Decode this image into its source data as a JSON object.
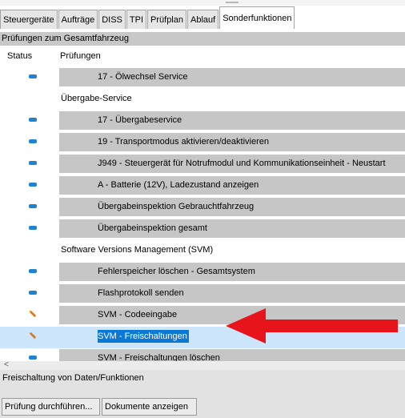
{
  "tabs": [
    {
      "label": "Steuergeräte",
      "active": false
    },
    {
      "label": "Aufträge",
      "active": false
    },
    {
      "label": "DISS",
      "active": false
    },
    {
      "label": "TPI",
      "active": false
    },
    {
      "label": "Prüfplan",
      "active": false
    },
    {
      "label": "Ablauf",
      "active": false
    },
    {
      "label": "Sonderfunktionen",
      "active": true
    }
  ],
  "section_header": "Prüfungen zum Gesamtfahrzeug",
  "columns": {
    "status": "Status",
    "pruefungen": "Prüfungen"
  },
  "rows": [
    {
      "type": "item",
      "label": "17 - Ölwechsel Service",
      "status_icon": "status-dash-icon"
    },
    {
      "type": "group",
      "label": "Übergabe-Service"
    },
    {
      "type": "item",
      "label": "17 - Übergabeservice",
      "status_icon": "status-dash-icon"
    },
    {
      "type": "item",
      "label": "19 - Transportmodus aktivieren/deaktivieren",
      "status_icon": "status-dash-icon"
    },
    {
      "type": "item",
      "label": "J949 - Steuergerät für Notrufmodul und Kommunikationseinheit - Neustart",
      "status_icon": "status-dash-icon"
    },
    {
      "type": "item",
      "label": "A - Batterie (12V), Ladezustand anzeigen",
      "status_icon": "status-dash-icon"
    },
    {
      "type": "item",
      "label": "Übergabeinspektion Gebrauchtfahrzeug",
      "status_icon": "status-dash-icon"
    },
    {
      "type": "item",
      "label": "Übergabeinspektion gesamt",
      "status_icon": "status-dash-icon"
    },
    {
      "type": "group",
      "label": "Software Versions Management (SVM)"
    },
    {
      "type": "item",
      "label": "Fehlerspeicher löschen - Gesamtsystem",
      "status_icon": "status-dash-icon"
    },
    {
      "type": "item",
      "label": "Flashprotokoll senden",
      "status_icon": "status-dash-icon"
    },
    {
      "type": "item",
      "label": "SVM - Codeeingabe",
      "status_icon": "pen-icon"
    },
    {
      "type": "item",
      "label": "SVM - Freischaltungen",
      "status_icon": "pen-icon",
      "selected": true
    },
    {
      "type": "item",
      "label": "SVM - Freischaltungen löschen",
      "status_icon": "status-dash-icon"
    }
  ],
  "scroll_left_glyph": "<",
  "status_text": "Freischaltung von Daten/Funktionen",
  "buttons": {
    "run": "Prüfung durchführen...",
    "docs": "Dokumente anzeigen"
  },
  "colors": {
    "selection_bg": "#cde6fb",
    "selection_highlight": "#0a78d7",
    "status_blue": "#1e83d2",
    "annotation_arrow": "#e8141c"
  }
}
